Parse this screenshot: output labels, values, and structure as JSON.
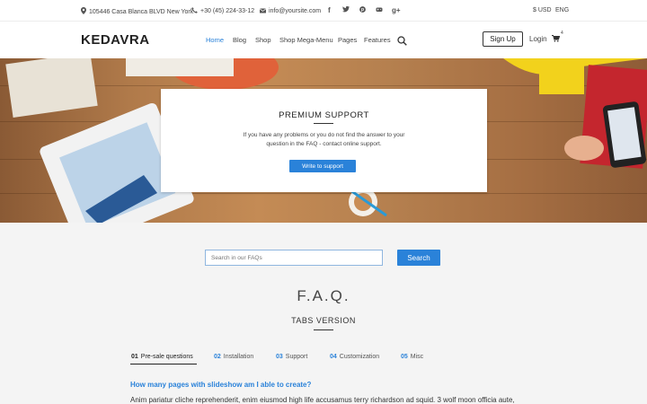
{
  "topbar": {
    "address": "105446 Casa Blanca BLVD New York",
    "phone": "+30 (45) 224-33-12",
    "email": "info@yoursite.com",
    "social": [
      "f",
      "t",
      "p",
      "g",
      "g+"
    ],
    "currency": "$ USD",
    "language": "ENG"
  },
  "nav": {
    "logo": "KEDAVRA",
    "items": [
      "Home",
      "Blog",
      "Shop",
      "Shop Mega-Menu",
      "Pages",
      "Features"
    ],
    "signup": "Sign Up",
    "login": "Login",
    "cart_count": "4"
  },
  "hero": {
    "title": "PREMIUM SUPPORT",
    "text": "If you have any problems or you do not find the answer to your question in the FAQ - contact online support.",
    "button": "Write to support"
  },
  "search": {
    "placeholder": "Search in our FAQs",
    "button": "Search"
  },
  "faq": {
    "title": "F.A.Q.",
    "subtitle": "TABS VERSION",
    "tabs": [
      {
        "num": "01",
        "label": "Pre-sale questions"
      },
      {
        "num": "02",
        "label": "Installation"
      },
      {
        "num": "03",
        "label": "Support"
      },
      {
        "num": "04",
        "label": "Customization"
      },
      {
        "num": "05",
        "label": "Misc"
      }
    ],
    "question": "How many pages with slideshow am I able to create?",
    "answer": "Anim pariatur cliche reprehenderit, enim eiusmod high life accusamus terry richardson ad squid. 3 wolf moon officia aute,"
  },
  "colors": {
    "accent": "#2a82d9",
    "background": "#f4f4f4"
  }
}
